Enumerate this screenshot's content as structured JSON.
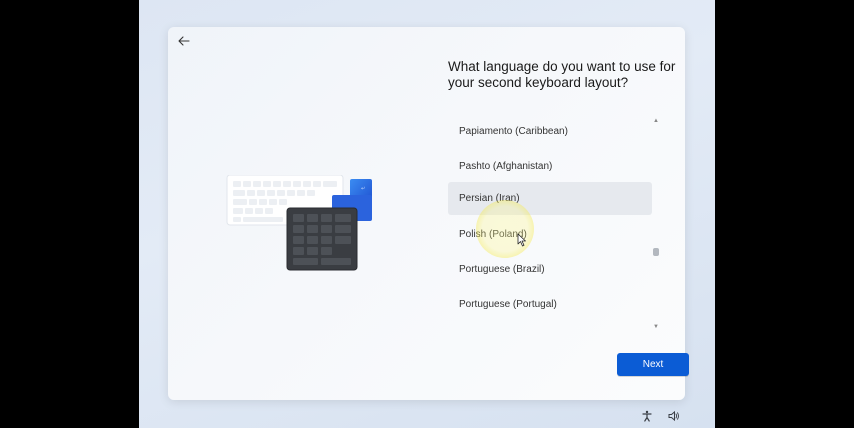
{
  "dialog": {
    "title": "What language do you want to use for your second keyboard layout?"
  },
  "languages": [
    {
      "label": "Papiamento (Caribbean)",
      "selected": false
    },
    {
      "label": "Pashto (Afghanistan)",
      "selected": false
    },
    {
      "label": "Persian (Iran)",
      "selected": true
    },
    {
      "label": "Polish (Poland)",
      "selected": false
    },
    {
      "label": "Portuguese (Brazil)",
      "selected": false
    },
    {
      "label": "Portuguese (Portugal)",
      "selected": false
    }
  ],
  "buttons": {
    "next_label": "Next"
  },
  "icons": {
    "back": "back-arrow-icon",
    "accessibility": "accessibility-icon",
    "volume": "volume-icon",
    "scroll_up": "chevron-up-icon",
    "scroll_down": "chevron-down-icon"
  },
  "colors": {
    "accent": "#0b5cd5",
    "selected_item": "#e6e9ee",
    "cursor_highlight": "#f5eb50"
  }
}
